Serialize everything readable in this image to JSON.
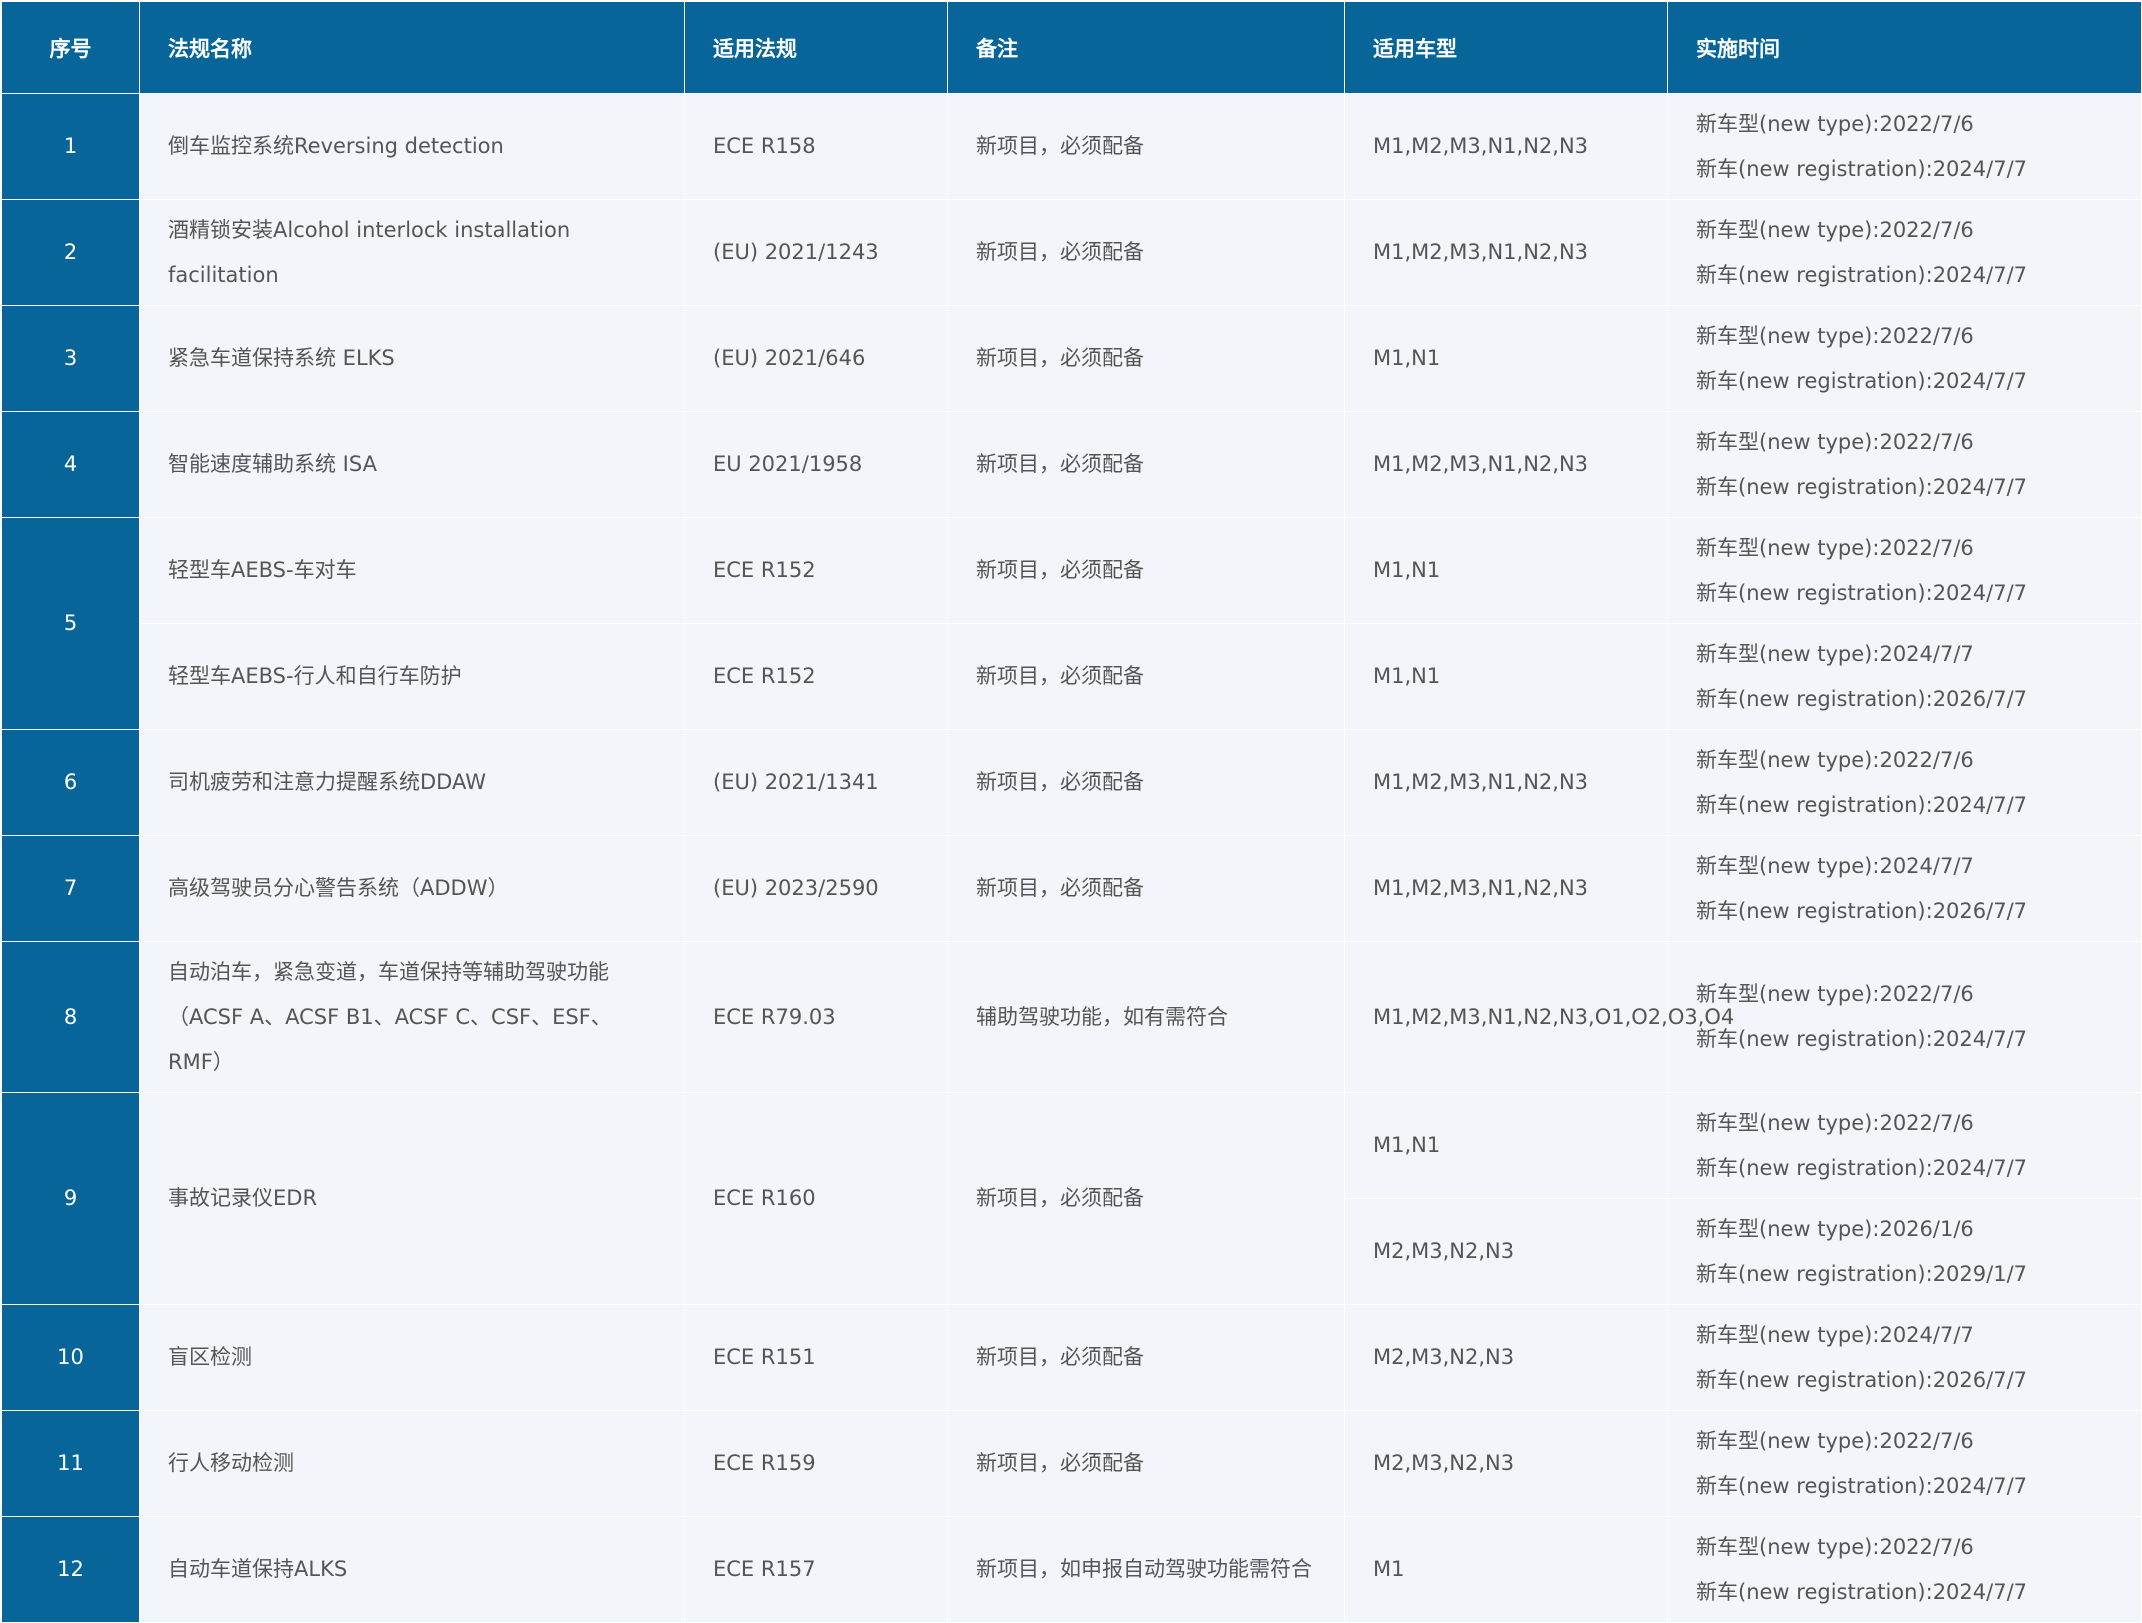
{
  "headers": [
    "序号",
    "法规名称",
    "适用法规",
    "备注",
    "适用车型",
    "实施时间"
  ],
  "rows": [
    {
      "no": "1",
      "name": "倒车监控系统Reversing detection",
      "reg": "ECE R158",
      "note": "新项目，必须配备",
      "vehicles": "M1,M2,M3,N1,N2,N3",
      "time": [
        "新车型(new type):2022/7/6",
        "新车(new registration):2024/7/7"
      ]
    },
    {
      "no": "2",
      "name": "酒精锁安装Alcohol interlock installation facilitation",
      "reg": "(EU) 2021/1243",
      "note": "新项目，必须配备",
      "vehicles": "M1,M2,M3,N1,N2,N3",
      "time": [
        "新车型(new type):2022/7/6",
        "新车(new registration):2024/7/7"
      ]
    },
    {
      "no": "3",
      "name": "紧急车道保持系统 ELKS",
      "reg": "(EU) 2021/646",
      "note": "新项目，必须配备",
      "vehicles": "M1,N1",
      "time": [
        "新车型(new type):2022/7/6",
        "新车(new registration):2024/7/7"
      ]
    },
    {
      "no": "4",
      "name": "智能速度辅助系统 ISA",
      "reg": "EU 2021/1958",
      "note": "新项目，必须配备",
      "vehicles": "M1,M2,M3,N1,N2,N3",
      "time": [
        "新车型(new type):2022/7/6",
        "新车(new registration):2024/7/7"
      ]
    },
    {
      "no": "5",
      "name": "轻型车AEBS-车对车",
      "reg": "ECE R152",
      "note": "新项目，必须配备",
      "vehicles": "M1,N1",
      "time": [
        "新车型(new type):2022/7/6",
        "新车(new registration):2024/7/7"
      ]
    },
    {
      "no": "",
      "name": "轻型车AEBS-行人和自行车防护",
      "reg": "ECE R152",
      "note": "新项目，必须配备",
      "vehicles": "M1,N1",
      "time": [
        "新车型(new type):2024/7/7",
        "新车(new registration):2026/7/7"
      ]
    },
    {
      "no": "6",
      "name": "司机疲劳和注意力提醒系统DDAW",
      "reg": "(EU) 2021/1341",
      "note": "新项目，必须配备",
      "vehicles": "M1,M2,M3,N1,N2,N3",
      "time": [
        "新车型(new type):2022/7/6",
        "新车(new registration):2024/7/7"
      ]
    },
    {
      "no": "7",
      "name": "高级驾驶员分心警告系统（ADDW）",
      "reg": "(EU) 2023/2590",
      "note": "新项目，必须配备",
      "vehicles": "M1,M2,M3,N1,N2,N3",
      "time": [
        "新车型(new type):2024/7/7",
        "新车(new registration):2026/7/7"
      ]
    },
    {
      "no": "8",
      "name": "自动泊车，紧急变道，车道保持等辅助驾驶功能（ACSF A、ACSF B1、ACSF C、CSF、ESF、RMF）",
      "reg": "ECE R79.03",
      "note": "辅助驾驶功能，如有需符合",
      "vehicles": "M1,M2,M3,N1,N2,N3,O1,O2,O3,O4",
      "time": [
        "新车型(new type):2022/7/6",
        "新车(new registration):2024/7/7"
      ]
    },
    {
      "no": "9",
      "name": "事故记录仪EDR",
      "reg": "ECE R160",
      "note": "新项目，必须配备",
      "vehicles": "M1,N1",
      "time": [
        "新车型(new type):2022/7/6",
        "新车(new registration):2024/7/7"
      ]
    },
    {
      "no": "",
      "name": "",
      "reg": "",
      "note": "",
      "vehicles": "M2,M3,N2,N3",
      "time": [
        "新车型(new type):2026/1/6",
        "新车(new registration):2029/1/7"
      ]
    },
    {
      "no": "10",
      "name": "盲区检测",
      "reg": "ECE R151",
      "note": "新项目，必须配备",
      "vehicles": "M2,M3,N2,N3",
      "time": [
        "新车型(new type):2024/7/7",
        "新车(new registration):2026/7/7"
      ]
    },
    {
      "no": "11",
      "name": "行人移动检测",
      "reg": "ECE R159",
      "note": "新项目，必须配备",
      "vehicles": "M2,M3,N2,N3",
      "time": [
        "新车型(new type):2022/7/6",
        "新车(new registration):2024/7/7"
      ]
    },
    {
      "no": "12",
      "name": "自动车道保持ALKS",
      "reg": "ECE R157",
      "note": "新项目，如申报自动驾驶功能需符合",
      "vehicles": "M1",
      "time": [
        "新车型(new type):2022/7/6",
        "新车(new registration):2024/7/7"
      ]
    }
  ]
}
